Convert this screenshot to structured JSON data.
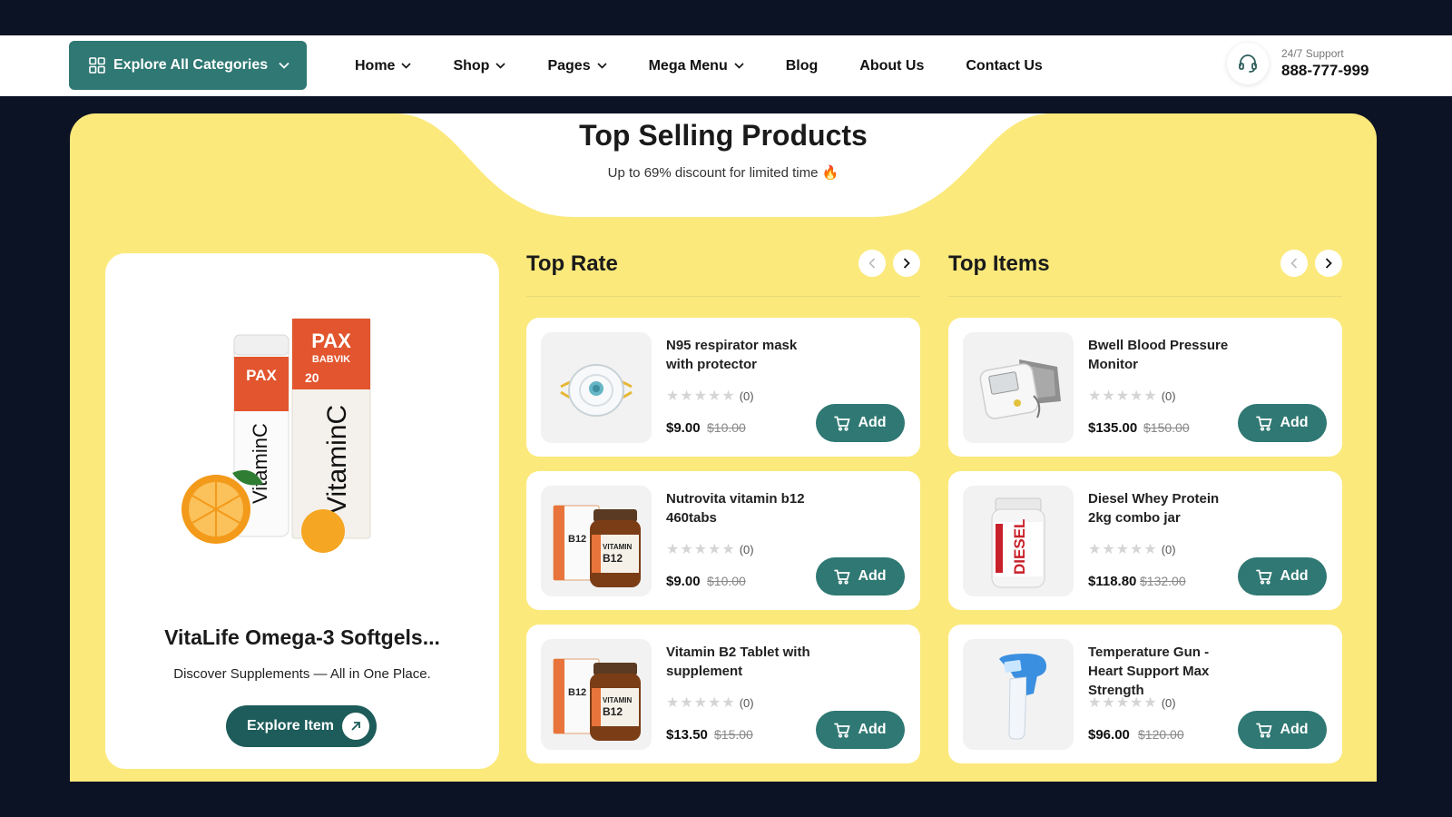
{
  "header": {
    "categories_button": "Explore All Categories",
    "nav": [
      {
        "label": "Home",
        "dropdown": true
      },
      {
        "label": "Shop",
        "dropdown": true
      },
      {
        "label": "Pages",
        "dropdown": true
      },
      {
        "label": "Mega Menu",
        "dropdown": true
      },
      {
        "label": "Blog",
        "dropdown": false
      },
      {
        "label": "About Us",
        "dropdown": false
      },
      {
        "label": "Contact Us",
        "dropdown": false
      }
    ],
    "support_label": "24/7 Support",
    "support_phone": "888-777-999"
  },
  "section": {
    "title": "Top Selling Products",
    "subtitle": "Up to 69% discount for limited time",
    "subtitle_emoji": "🔥"
  },
  "promo": {
    "title": "VitaLife Omega-3 Softgels...",
    "description": "Discover Supplements — All in One Place.",
    "button": "Explore Item",
    "image_text": {
      "brand": "PAX",
      "sub": "BABVIK",
      "label": "VitaminC",
      "count": "20"
    }
  },
  "columns": [
    {
      "title": "Top Rate",
      "products": [
        {
          "name": "N95 respirator mask with protector",
          "rating_count": "(0)",
          "price": "$9.00",
          "old_price": "$10.00",
          "add": "Add",
          "image": "mask"
        },
        {
          "name": "Nutrovita vitamin b12 460tabs",
          "rating_count": "(0)",
          "price": "$9.00",
          "old_price": "$10.00",
          "add": "Add",
          "image": "vitamin-b12"
        },
        {
          "name": "Vitamin B2 Tablet with supplement",
          "rating_count": "(0)",
          "price": "$13.50",
          "old_price": "$15.00",
          "add": "Add",
          "image": "vitamin-b12"
        }
      ]
    },
    {
      "title": "Top Items",
      "products": [
        {
          "name": "Bwell Blood Pressure Monitor",
          "rating_count": "(0)",
          "price": "$135.00",
          "old_price": "$150.00",
          "add": "Add",
          "image": "bp-monitor"
        },
        {
          "name": "Diesel Whey Protein 2kg combo jar",
          "rating_count": "(0)",
          "price": "$118.80",
          "old_price": "$132.00",
          "add": "Add",
          "image": "protein-jar",
          "image_text": "DIESEL"
        },
        {
          "name": "Temperature Gun - Heart Support Max Strength",
          "rating_count": "(0)",
          "price": "$96.00",
          "old_price": "$120.00",
          "add": "Add",
          "image": "thermometer"
        }
      ]
    }
  ],
  "rating_stars": 0,
  "colors": {
    "accent": "#2f7873",
    "yellow": "#fbe97c",
    "dark": "#0c1324"
  }
}
